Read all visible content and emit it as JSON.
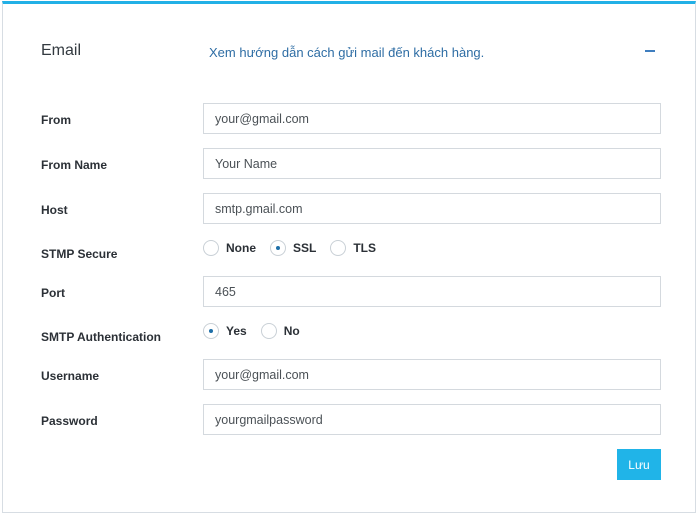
{
  "header": {
    "title": "Email",
    "guide_link": "Xem hướng dẫn cách gửi mail đến khách hàng.",
    "collapse_symbol": "−"
  },
  "fields": {
    "from": {
      "label": "From",
      "value": "your@gmail.com"
    },
    "from_name": {
      "label": "From Name",
      "value": "Your Name"
    },
    "host": {
      "label": "Host",
      "value": "smtp.gmail.com"
    },
    "secure": {
      "label": "STMP Secure",
      "options": [
        "None",
        "SSL",
        "TLS"
      ],
      "selected": "SSL"
    },
    "port": {
      "label": "Port",
      "value": "465"
    },
    "auth": {
      "label": "SMTP Authentication",
      "options": [
        "Yes",
        "No"
      ],
      "selected": "Yes"
    },
    "username": {
      "label": "Username",
      "value": "your@gmail.com"
    },
    "password": {
      "label": "Password",
      "value": "yourgmailpassword"
    }
  },
  "actions": {
    "save_label": "Lưu"
  },
  "colors": {
    "accent": "#22b0e6",
    "link": "#2e6da4",
    "button": "#20b4e8"
  }
}
